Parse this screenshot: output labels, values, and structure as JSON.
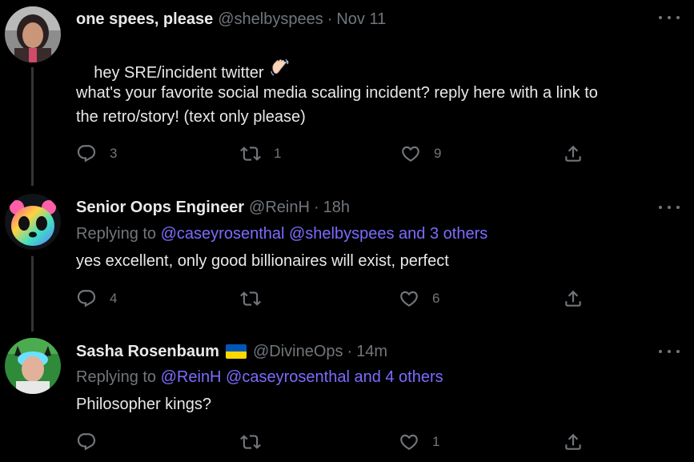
{
  "tweets": [
    {
      "name": "one spees, please",
      "handle": "@shelbyspees",
      "dot": "·",
      "time": "Nov 11",
      "body_line1": "hey SRE/incident twitter",
      "body_rest": "what's your favorite social media scaling incident? reply here with a link to\nthe retro/story! (text only please)",
      "replies": "3",
      "retweets": "1",
      "likes": "9"
    },
    {
      "name": "Senior Oops Engineer",
      "handle": "@ReinH",
      "dot": "·",
      "time": "18h",
      "replying_prefix": "Replying to ",
      "replying_mentions": "@caseyrosenthal @shelbyspees and 3 others",
      "body": "yes excellent, only good billionaires will exist, perfect",
      "replies": "4",
      "retweets": "",
      "likes": "6"
    },
    {
      "name": "Sasha Rosenbaum",
      "handle": "@DivineOps",
      "dot": "·",
      "time": "14m",
      "replying_prefix": "Replying to ",
      "replying_mentions": "@ReinH @caseyrosenthal and 4 others",
      "body": "Philosopher kings?",
      "replies": "",
      "retweets": "",
      "likes": "1"
    }
  ],
  "colors": {
    "background": "#000000",
    "text": "#e7e9ea",
    "muted": "#71767b",
    "mention": "#7b6cff",
    "thread_line": "#333639"
  },
  "icons": [
    "more-icon",
    "reply-icon",
    "retweet-icon",
    "like-icon",
    "share-icon",
    "waving-hand-icon",
    "ukraine-flag-icon"
  ]
}
